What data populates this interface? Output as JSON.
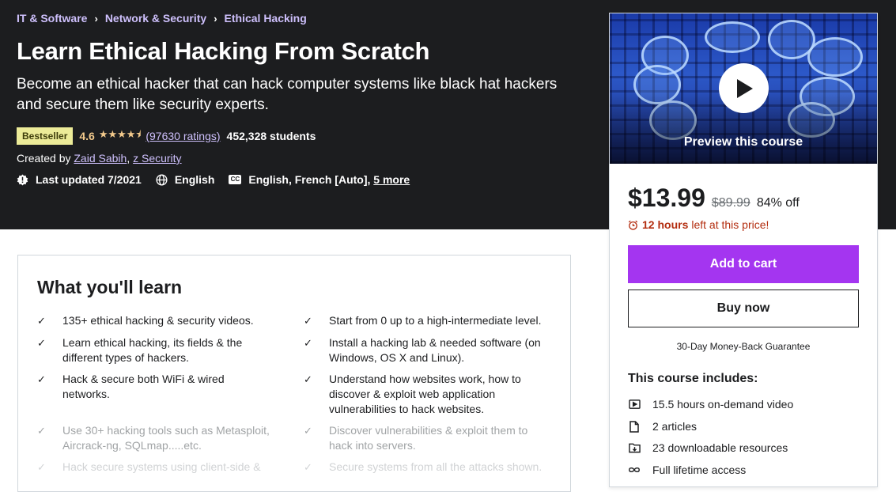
{
  "breadcrumb": [
    "IT & Software",
    "Network & Security",
    "Ethical Hacking"
  ],
  "course": {
    "title": "Learn Ethical Hacking From Scratch",
    "subtitle": "Become an ethical hacker that can hack computer systems like black hat hackers and secure them like security experts.",
    "badge": "Bestseller",
    "rating": "4.6",
    "stars_value": 4.6,
    "ratings_count": "(97630 ratings)",
    "students": "452,328 students",
    "created_by_label": "Created by",
    "instructors": [
      "Zaid Sabih",
      "z Security"
    ],
    "last_updated": "Last updated 7/2021",
    "language": "English",
    "captions": "English, French [Auto],",
    "captions_more": "5 more"
  },
  "sidebar": {
    "preview_label": "Preview this course",
    "price": "$13.99",
    "original_price": "$89.99",
    "discount": "84% off",
    "timer_hours": "12 hours",
    "timer_text": "left at this price!",
    "add_to_cart": "Add to cart",
    "buy_now": "Buy now",
    "guarantee": "30-Day Money-Back Guarantee",
    "includes_title": "This course includes:",
    "includes": [
      {
        "icon": "video-icon",
        "text": "15.5 hours on-demand video"
      },
      {
        "icon": "article-icon",
        "text": "2 articles"
      },
      {
        "icon": "download-icon",
        "text": "23 downloadable resources"
      },
      {
        "icon": "infinity-icon",
        "text": "Full lifetime access"
      }
    ]
  },
  "learn": {
    "title": "What you'll learn",
    "items": [
      "135+ ethical hacking & security videos.",
      "Start from 0 up to a high-intermediate level.",
      "Learn ethical hacking, its fields & the different types of hackers.",
      "Install a hacking lab & needed software (on Windows, OS X and Linux).",
      "Hack & secure both WiFi & wired networks.",
      "Understand how websites work, how to discover & exploit web application vulnerabilities to hack websites.",
      "Use 30+ hacking tools such as Metasploit, Aircrack-ng, SQLmap.....etc.",
      "Discover vulnerabilities & exploit them to hack into servers.",
      "Hack secure systems using client-side &",
      "Secure systems from all the attacks shown."
    ]
  },
  "colors": {
    "hero_bg": "#1c1d1f",
    "accent_purple": "#a435f0",
    "link_purple": "#cec0fc",
    "star": "#f3ca8c",
    "badge_bg": "#eceb98",
    "timer_red": "#b32d0f"
  }
}
